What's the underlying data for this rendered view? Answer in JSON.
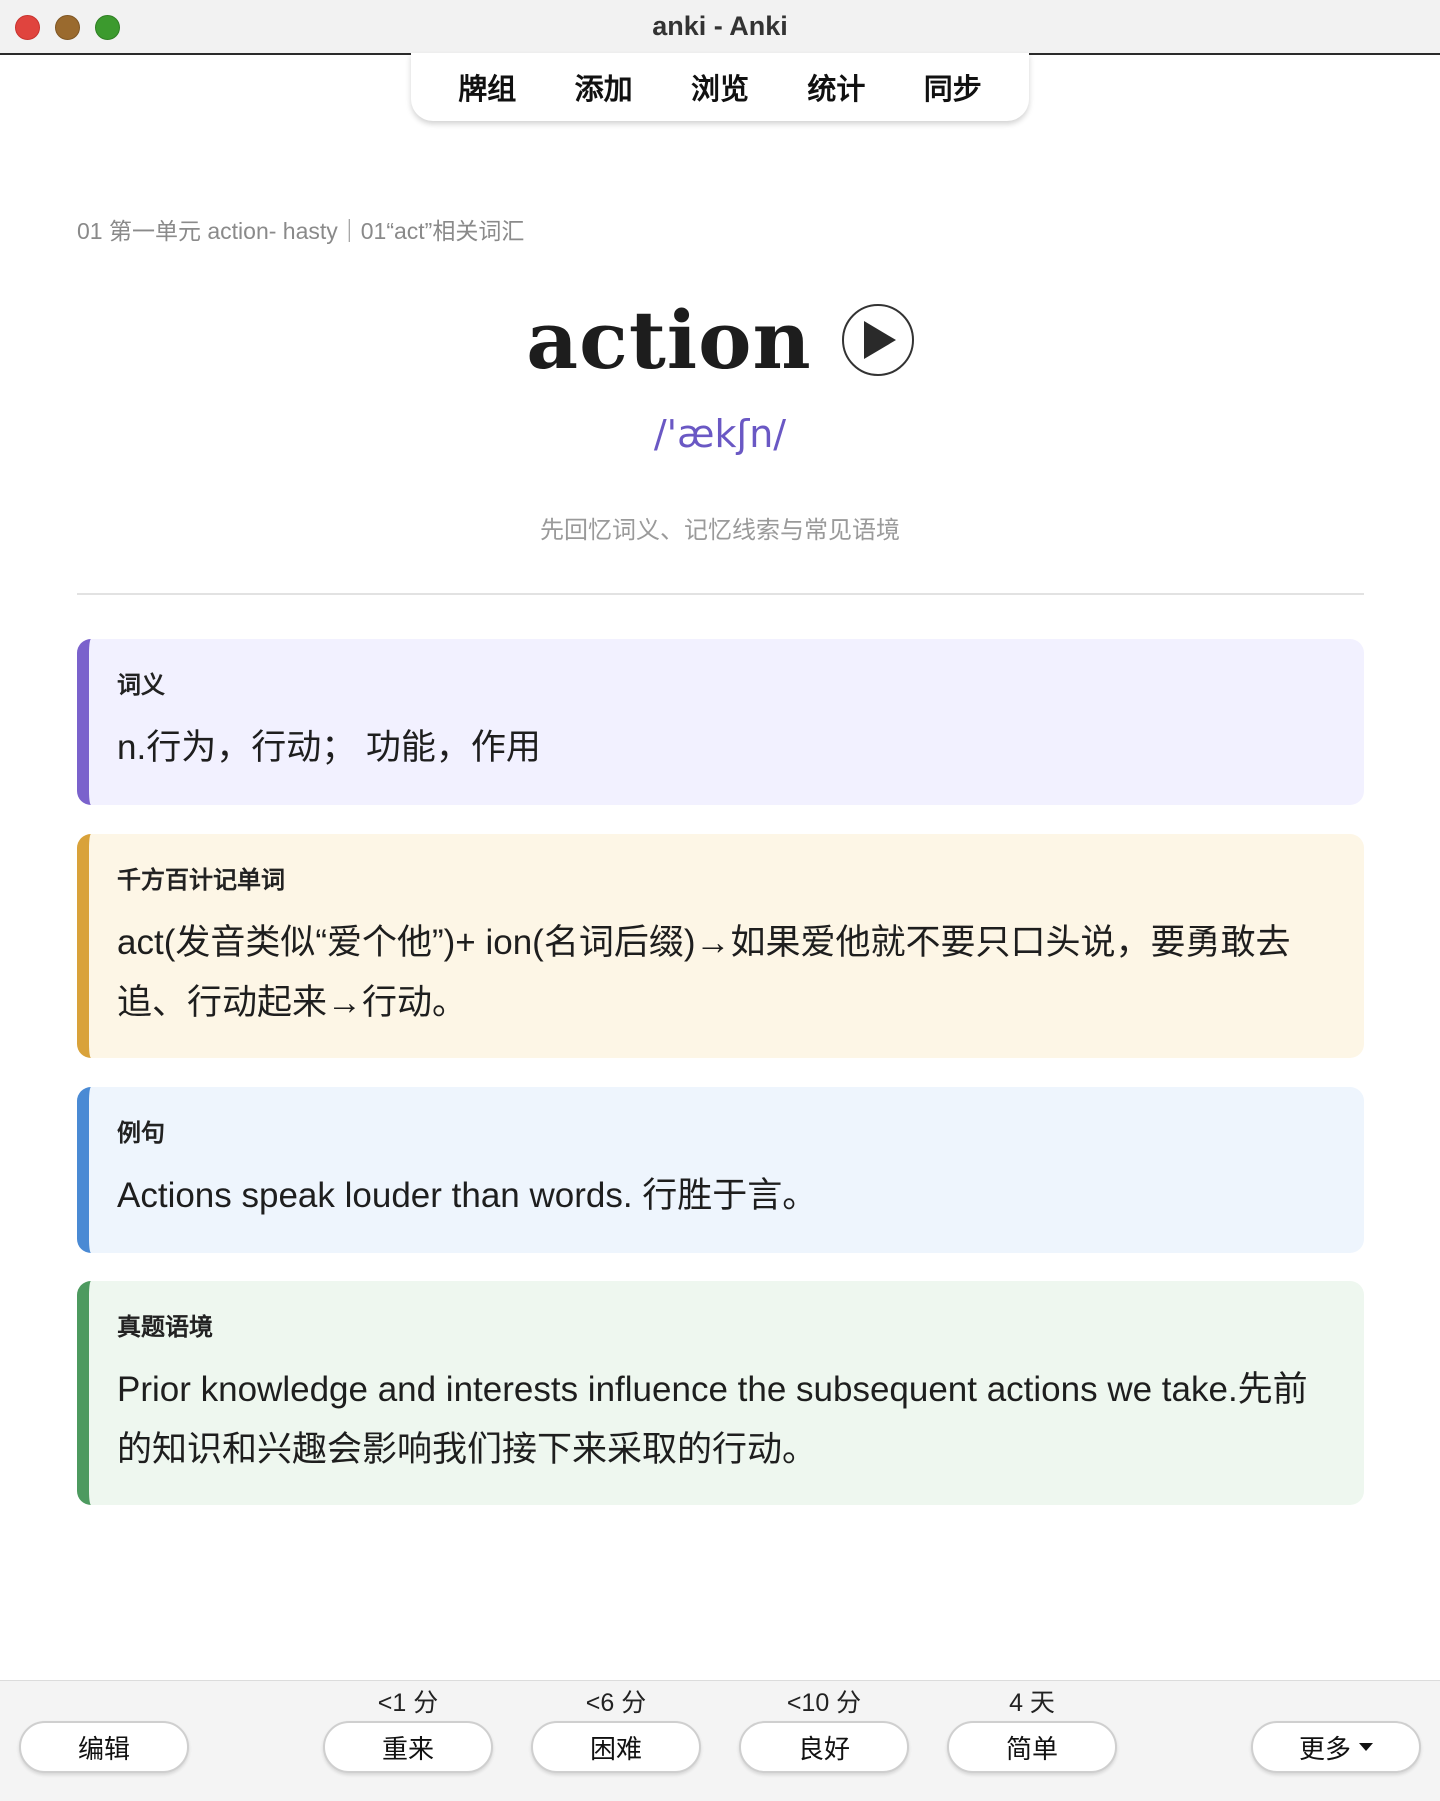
{
  "window": {
    "title": "anki - Anki"
  },
  "toolbar": {
    "items": [
      "牌组",
      "添加",
      "浏览",
      "统计",
      "同步"
    ]
  },
  "card": {
    "deck_path": "01 第一单元 action- hasty｜01“act”相关词汇",
    "word": "action",
    "phonetic": "/'ækʃn/",
    "hint": "先回忆词义、记忆线索与常见语境",
    "sections": {
      "meaning": {
        "label": "词义",
        "text": "n.行为，行动； 功能，作用"
      },
      "memory": {
        "label": "千方百计记单词",
        "text": "act(发音类似“爱个他”)+ ion(名词后缀)→如果爱他就不要只口头说，要勇敢去追、行动起来→行动。"
      },
      "example": {
        "label": "例句",
        "text": "Actions speak louder than words. 行胜于言。"
      },
      "context": {
        "label": "真题语境",
        "text": "Prior knowledge and interests influence the subsequent actions we take.先前的知识和兴趣会影响我们接下来采取的行动。"
      }
    }
  },
  "answer_bar": {
    "edit_label": "编辑",
    "more_label": "更多",
    "buttons": [
      {
        "interval": "<1 分",
        "label": "重来"
      },
      {
        "interval": "<6 分",
        "label": "困难"
      },
      {
        "interval": "<10 分",
        "label": "良好"
      },
      {
        "interval": "4 天",
        "label": "简单"
      }
    ]
  },
  "colors": {
    "phonetic": "#6a58c4",
    "meaning_accent": "#7a62cc",
    "memory_accent": "#d9a23a",
    "example_accent": "#4a8ad4",
    "context_accent": "#4d9a5f"
  },
  "icons": {
    "play": "play-icon",
    "dropdown": "chevron-down-icon"
  }
}
